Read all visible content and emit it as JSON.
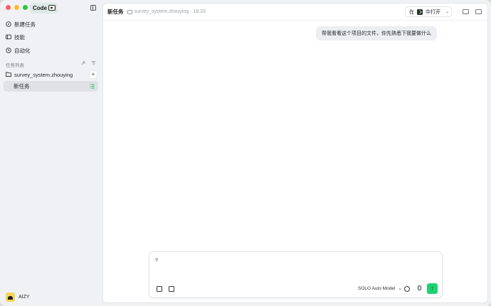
{
  "sidebar": {
    "mode_label": "Code",
    "nav": [
      {
        "label": "新建任务",
        "icon": "new-task-icon"
      },
      {
        "label": "技能",
        "icon": "skills-icon"
      },
      {
        "label": "自动化",
        "icon": "clock-icon"
      }
    ],
    "section_label": "任务列表",
    "project": {
      "name": "survey_system.zhouying",
      "add_label": "+"
    },
    "task": {
      "label": "新任务"
    },
    "user": {
      "name": "AIZY"
    }
  },
  "header": {
    "title": "新任务",
    "breadcrumb": "survey_system.zhouying · 18:33",
    "open_in": {
      "prefix": "在",
      "suffix": "中打开"
    }
  },
  "conversation": {
    "user_message": "帮我看看这个项目的文件，你先熟悉下我要做什么"
  },
  "composer": {
    "text": "?",
    "model": "SOLO Auto Model",
    "send_icon": "↑"
  },
  "colors": {
    "accent": "#1fd270",
    "sidebar_bg": "#f0f1f4",
    "selected_bg": "#dfe1e5"
  }
}
